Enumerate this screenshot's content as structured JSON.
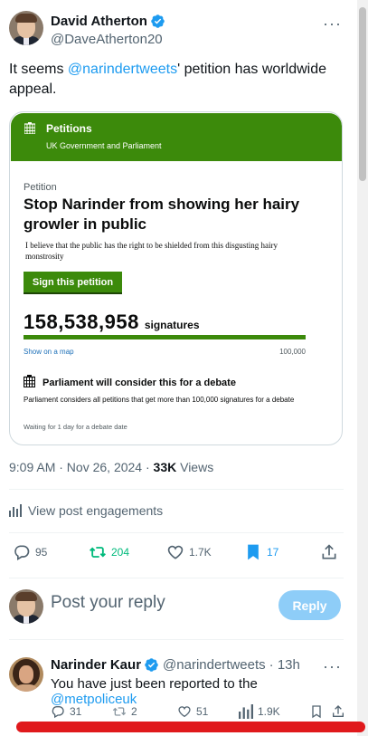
{
  "post": {
    "author_name": "David Atherton",
    "author_handle": "@DaveAtherton20",
    "text_before": "It seems ",
    "mention": "@narindertweets",
    "text_after": "' petition has worldwide appeal.",
    "timestamp": "9:09 AM · Nov 26, 2024 · ",
    "views_count": "33K",
    "views_label": " Views",
    "engagements_label": "View post engagements",
    "stats": {
      "replies": "95",
      "reposts": "204",
      "likes": "1.7K",
      "bookmarks": "17"
    }
  },
  "card": {
    "header_title": "Petitions",
    "header_subtitle": "UK Government and Parliament",
    "petition_label": "Petition",
    "petition_title": "Stop Narinder from showing her hairy growler in public",
    "petition_description": "I believe that the public has the right to be shielded from this disgusting hairy monstrosity",
    "sign_button": "Sign this petition",
    "signature_count": "158,538,958",
    "signature_label": "signatures",
    "progress_fraction": 1.0,
    "map_link": "Show on a map",
    "target": "100,000",
    "debate_title": "Parliament will consider this for a debate",
    "debate_description": "Parliament considers all petitions that get more than 100,000 signatures for a debate",
    "debate_wait": "Waiting for 1 day for a debate date"
  },
  "reply_composer": {
    "placeholder": "Post your reply",
    "button": "Reply"
  },
  "reply_tweet": {
    "author_name": "Narinder Kaur",
    "author_handle": "@narindertweets",
    "time": "· 13h",
    "text_before": "You have just been reported to the ",
    "mention": "@metpoliceuk",
    "stats": {
      "replies": "31",
      "reposts": "2",
      "likes": "51",
      "views": "1.9K"
    }
  },
  "colors": {
    "accent": "#1d9bf0",
    "petition_green": "#3c8a0b",
    "repost_green": "#00ba7c",
    "annotation_red": "#e0191c"
  }
}
